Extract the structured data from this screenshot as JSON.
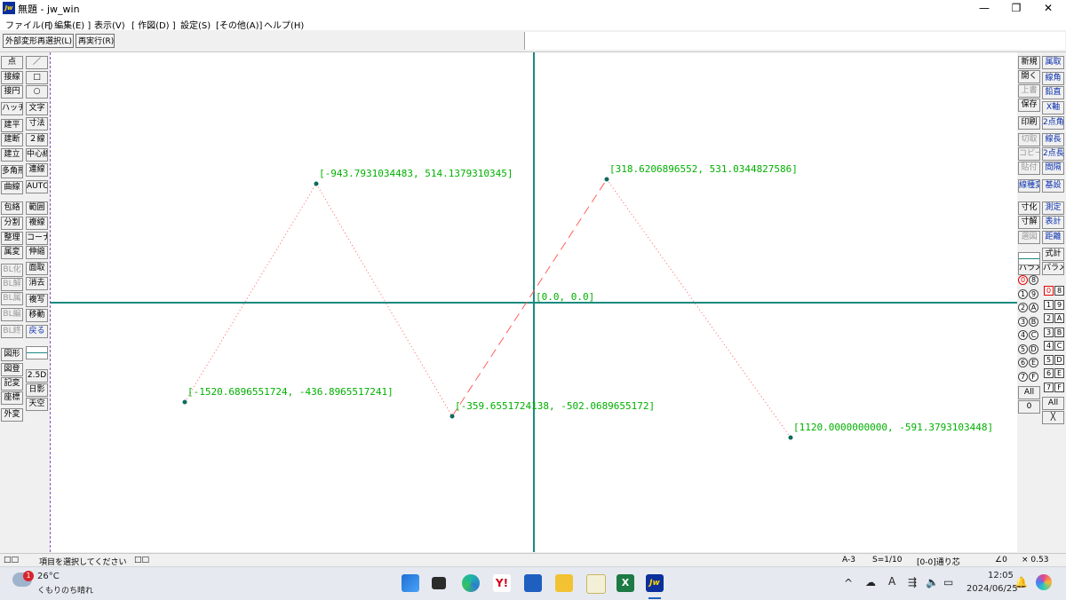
{
  "window": {
    "title": "無題 - jw_win",
    "app_icon_text": "Jw",
    "minimize": "—",
    "maximize": "❐",
    "close": "✕"
  },
  "menu": [
    "ファイル(F)",
    "[ 編集(E) ]",
    "表示(V)",
    "[ 作図(D) ]",
    "設定(S)",
    "[その他(A)]",
    "ヘルプ(H)"
  ],
  "toolbar": {
    "reselect_label": "外部変形再選択(L)",
    "rerun_label": "再実行(R)"
  },
  "left_palette": {
    "col1": [
      "点",
      "接線",
      "接円",
      "ハッチ",
      "建平",
      "建断",
      "建立",
      "多角形",
      "曲線",
      "包絡",
      "分割",
      "整理",
      "属変",
      "BL化",
      "BL解",
      "BL属",
      "BL編",
      "BL終",
      "図形",
      "図登",
      "記変",
      "座標",
      "外変"
    ],
    "col2": [
      "／",
      "□",
      "○",
      "文字",
      "寸法",
      "２線",
      "中心線",
      "連線",
      "AUTO",
      "範囲",
      "複線",
      "コーナー",
      "伸縮",
      "面取",
      "消去",
      "複写",
      "移動",
      "戻る",
      "2.5D",
      "日影",
      "天空"
    ]
  },
  "right_palette": {
    "col1": [
      "新規",
      "開く",
      "上書",
      "保存",
      "印刷",
      "切取",
      "コピー",
      "貼付",
      "線種変更",
      "寸化",
      "寸解",
      "選図",
      "式計",
      "パラメ"
    ],
    "col2": [
      "属取",
      "線角",
      "鉛直",
      "X軸",
      "2点角",
      "線長",
      "2点長",
      "間隔",
      "基設",
      "測定",
      "表計",
      "距離"
    ],
    "layer_groups": [
      "0",
      "1",
      "2",
      "3",
      "4",
      "5",
      "6",
      "7"
    ],
    "group_letters": [
      "8",
      "9",
      "A",
      "B",
      "C",
      "D",
      "E",
      "F"
    ],
    "layers": [
      "0",
      "1",
      "2",
      "3",
      "4",
      "5",
      "6",
      "7"
    ],
    "layer_letters": [
      "8",
      "9",
      "A",
      "B",
      "C",
      "D",
      "E",
      "F"
    ],
    "all_label": "All",
    "zero_label": "0",
    "all_label2": "All",
    "x_label": "╳"
  },
  "drawing": {
    "origin_label": "[0.0, 0.0]",
    "points": [
      {
        "label": "[-1520.6896551724, -436.8965517241]"
      },
      {
        "label": "[-943.7931034483, 514.1379310345]"
      },
      {
        "label": "[-359.6551724138, -502.0689655172]"
      },
      {
        "label": "[318.6206896552, 531.0344827586]"
      },
      {
        "label": "[1120.0000000000, -591.3793103448]"
      }
    ],
    "axis_color": "#1a8a80",
    "label_color": "#00b000",
    "line_color": "#ff6060"
  },
  "status": {
    "left_icons": "□□",
    "message": "項目を選択してください",
    "icons2": "□□",
    "paper": "A-3",
    "scale": "S=1/10",
    "layer": "[0-0]通り芯",
    "angle": "∠0",
    "factor": "× 0.53"
  },
  "taskbar": {
    "weather_temp": "26°C",
    "weather_desc": "くもりのち晴れ",
    "badge": "1",
    "time": "12:05",
    "date": "2024/06/25",
    "ime": "A",
    "chevron": "^"
  }
}
